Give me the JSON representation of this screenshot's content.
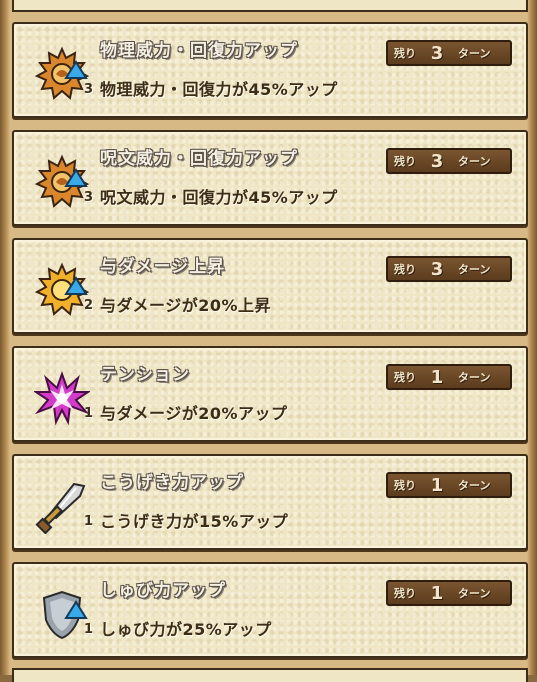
{
  "turn_badge": {
    "prefix": "残り",
    "suffix": "ターン"
  },
  "effects": [
    {
      "icon": "spiked-orb-icon",
      "color": "#d9862d",
      "title": "物理威力・回復力アップ",
      "description": "物理威力・回復力が45%アップ",
      "stack": "3",
      "turns": "3"
    },
    {
      "icon": "spiked-orb-icon",
      "color": "#d9862d",
      "title": "呪文威力・回復力アップ",
      "description": "呪文威力・回復力が45%アップ",
      "stack": "3",
      "turns": "3"
    },
    {
      "icon": "spiked-orb-icon",
      "color": "#f0b02a",
      "title": "与ダメージ上昇",
      "description": "与ダメージが20%上昇",
      "stack": "2",
      "turns": "3"
    },
    {
      "icon": "tension-burst-icon",
      "color": "#d23cc9",
      "title": "テンション",
      "description": "与ダメージが20%アップ",
      "stack": "1",
      "turns": "1"
    },
    {
      "icon": "sword-icon",
      "color": "#c6c6c6",
      "title": "こうげき力アップ",
      "description": "こうげき力が15%アップ",
      "stack": "1",
      "turns": "1"
    },
    {
      "icon": "shield-icon",
      "color": "#9aa3ab",
      "title": "しゅび力アップ",
      "description": "しゅび力が25%アップ",
      "stack": "1",
      "turns": "1"
    }
  ]
}
